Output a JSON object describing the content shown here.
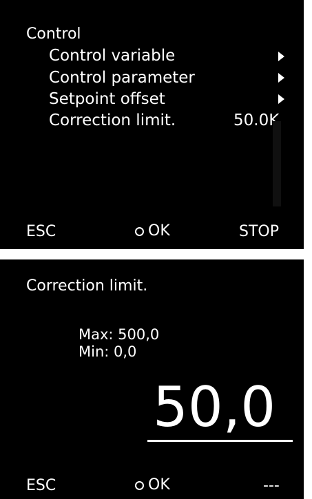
{
  "menu_screen": {
    "title": "Control",
    "items": [
      {
        "label": "Control variable",
        "has_submenu": true,
        "value": ""
      },
      {
        "label": "Control parameter",
        "has_submenu": true,
        "value": ""
      },
      {
        "label": "Setpoint offset",
        "has_submenu": true,
        "value": ""
      },
      {
        "label": "Correction limit.",
        "has_submenu": false,
        "value": "50.0K"
      }
    ],
    "footer": {
      "left": "ESC",
      "center": "OK",
      "right": "STOP"
    }
  },
  "edit_screen": {
    "title": "Correction limit.",
    "max_label": "Max: 500,0",
    "min_label": "Min: 0,0",
    "value": "50,0",
    "footer": {
      "left": "ESC",
      "center": "OK",
      "right": "---"
    }
  },
  "colors": {
    "screen_background": "#000000",
    "text": "#ffffff",
    "frame": "#ffffff"
  },
  "icons": {
    "submenu": "triangle-right-icon",
    "ok": "circle-icon"
  }
}
